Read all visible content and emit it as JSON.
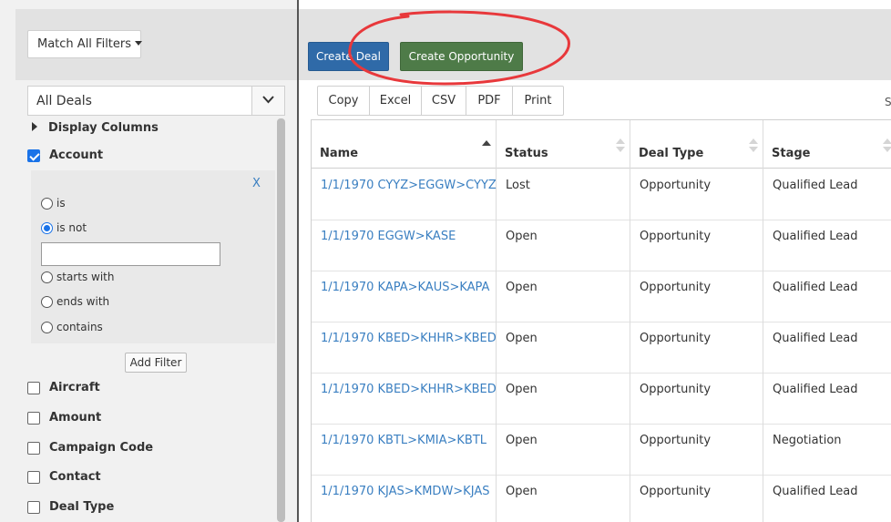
{
  "filters_panel": {
    "match_filters_label": "Match All Filters",
    "view_select_value": "All Deals",
    "display_columns_label": "Display Columns",
    "account_filter": {
      "label": "Account",
      "checked": true,
      "close_label": "X",
      "operators": [
        {
          "label": "is",
          "selected": false
        },
        {
          "label": "is not",
          "selected": true
        },
        {
          "label": "starts with",
          "selected": false
        },
        {
          "label": "ends with",
          "selected": false
        },
        {
          "label": "contains",
          "selected": false
        }
      ],
      "value": ""
    },
    "add_filter_label": "Add Filter",
    "fields": [
      {
        "label": "Aircraft",
        "checked": false
      },
      {
        "label": "Amount",
        "checked": false
      },
      {
        "label": "Campaign Code",
        "checked": false
      },
      {
        "label": "Contact",
        "checked": false
      },
      {
        "label": "Deal Type",
        "checked": false
      }
    ]
  },
  "toolbar": {
    "create_deal_label": "Create Deal",
    "create_opportunity_label": "Create Opportunity",
    "create_deal_color": "#2f6aa8",
    "create_opportunity_color": "#4e7b48",
    "highlight_color": "#e8383b"
  },
  "export_buttons": [
    "Copy",
    "Excel",
    "CSV",
    "PDF",
    "Print"
  ],
  "search_label_partial": "S",
  "table": {
    "columns": [
      {
        "label": "Name",
        "sort": "asc"
      },
      {
        "label": "Status",
        "sort": "none"
      },
      {
        "label": "Deal Type",
        "sort": "none"
      },
      {
        "label": "Stage",
        "sort": "none"
      }
    ],
    "rows": [
      {
        "name": "1/1/1970 CYYZ>EGGW>CYYZ",
        "status": "Lost",
        "deal_type": "Opportunity",
        "stage": "Qualified Lead"
      },
      {
        "name": "1/1/1970 EGGW>KASE",
        "status": "Open",
        "deal_type": "Opportunity",
        "stage": "Qualified Lead"
      },
      {
        "name": "1/1/1970 KAPA>KAUS>KAPA",
        "status": "Open",
        "deal_type": "Opportunity",
        "stage": "Qualified Lead"
      },
      {
        "name": "1/1/1970 KBED>KHHR>KBED",
        "status": "Open",
        "deal_type": "Opportunity",
        "stage": "Qualified Lead"
      },
      {
        "name": "1/1/1970 KBED>KHHR>KBED",
        "status": "Open",
        "deal_type": "Opportunity",
        "stage": "Qualified Lead"
      },
      {
        "name": "1/1/1970 KBTL>KMIA>KBTL",
        "status": "Open",
        "deal_type": "Opportunity",
        "stage": "Negotiation"
      },
      {
        "name": "1/1/1970 KJAS>KMDW>KJAS",
        "status": "Open",
        "deal_type": "Opportunity",
        "stage": "Qualified Lead"
      }
    ]
  }
}
